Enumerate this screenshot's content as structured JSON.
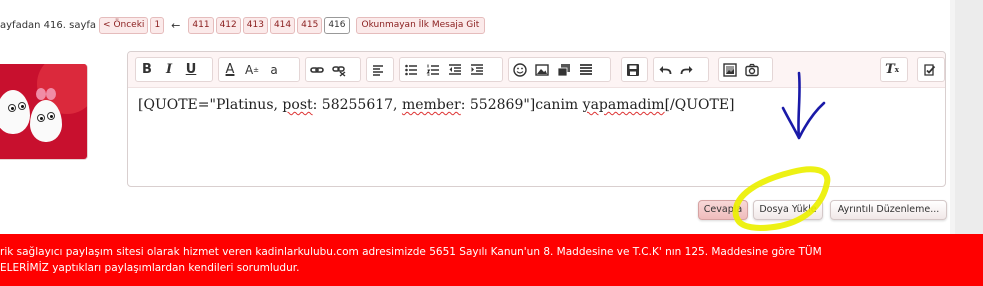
{
  "pagination": {
    "page_info": "ayfadan 416. sayfa",
    "prev_label": "< Önceki",
    "first_page": "1",
    "ellipsis_arrow": "←",
    "pages": [
      "411",
      "412",
      "413",
      "414",
      "415",
      "416"
    ],
    "current_page": "416",
    "unread_label": "Okunmayan İlk Mesaja Git"
  },
  "editor": {
    "toolbar_icons": [
      "bold-icon",
      "italic-icon",
      "underline-icon",
      "text-color-icon",
      "font-size-icon",
      "font-family-icon",
      "link-icon",
      "unlink-icon",
      "align-icon",
      "bullet-list-icon",
      "numbered-list-icon",
      "outdent-icon",
      "indent-icon",
      "smilie-icon",
      "image-icon",
      "media-icon",
      "quote-icon",
      "save-icon",
      "undo-icon",
      "redo-icon",
      "photo-icon",
      "camera-icon",
      "remove-format-icon",
      "toggle-bbcode-icon"
    ],
    "bold_label": "B",
    "italic_label": "I",
    "underline_label": "U",
    "text_color_label": "A",
    "font_size_label": "A",
    "font_size_sup": "±",
    "font_family_label": "a",
    "remove_format_label": "T",
    "content_prefix": "[QUOTE=\"Platinus, ",
    "content_post": "post",
    "content_mid": ": 58255617, ",
    "content_member": "member",
    "content_mid2": ": 552869\"]canim ",
    "content_word": "yapamadim",
    "content_suffix": "[/QUOTE]"
  },
  "buttons": {
    "reply": "Cevapla",
    "upload": "Dosya Yükle",
    "advanced": "Ayrıntılı Düzenleme..."
  },
  "footer": {
    "notice": "rik sağlayıcı paylaşım sitesi olarak hizmet veren kadinlarkulubu.com adresimizde 5651 Sayılı Kanun'un 8. Maddesine ve T.C.K' nın 125. Maddesine göre TÜM\nELERİMİZ yaptıkları paylaşımlardan kendileri sorumludur."
  },
  "colors": {
    "footer_bg": "#ff0000",
    "page_button_bg": "#fbeaea",
    "annotation_arrow": "#1a1aa8",
    "annotation_highlight": "#ecf000"
  }
}
